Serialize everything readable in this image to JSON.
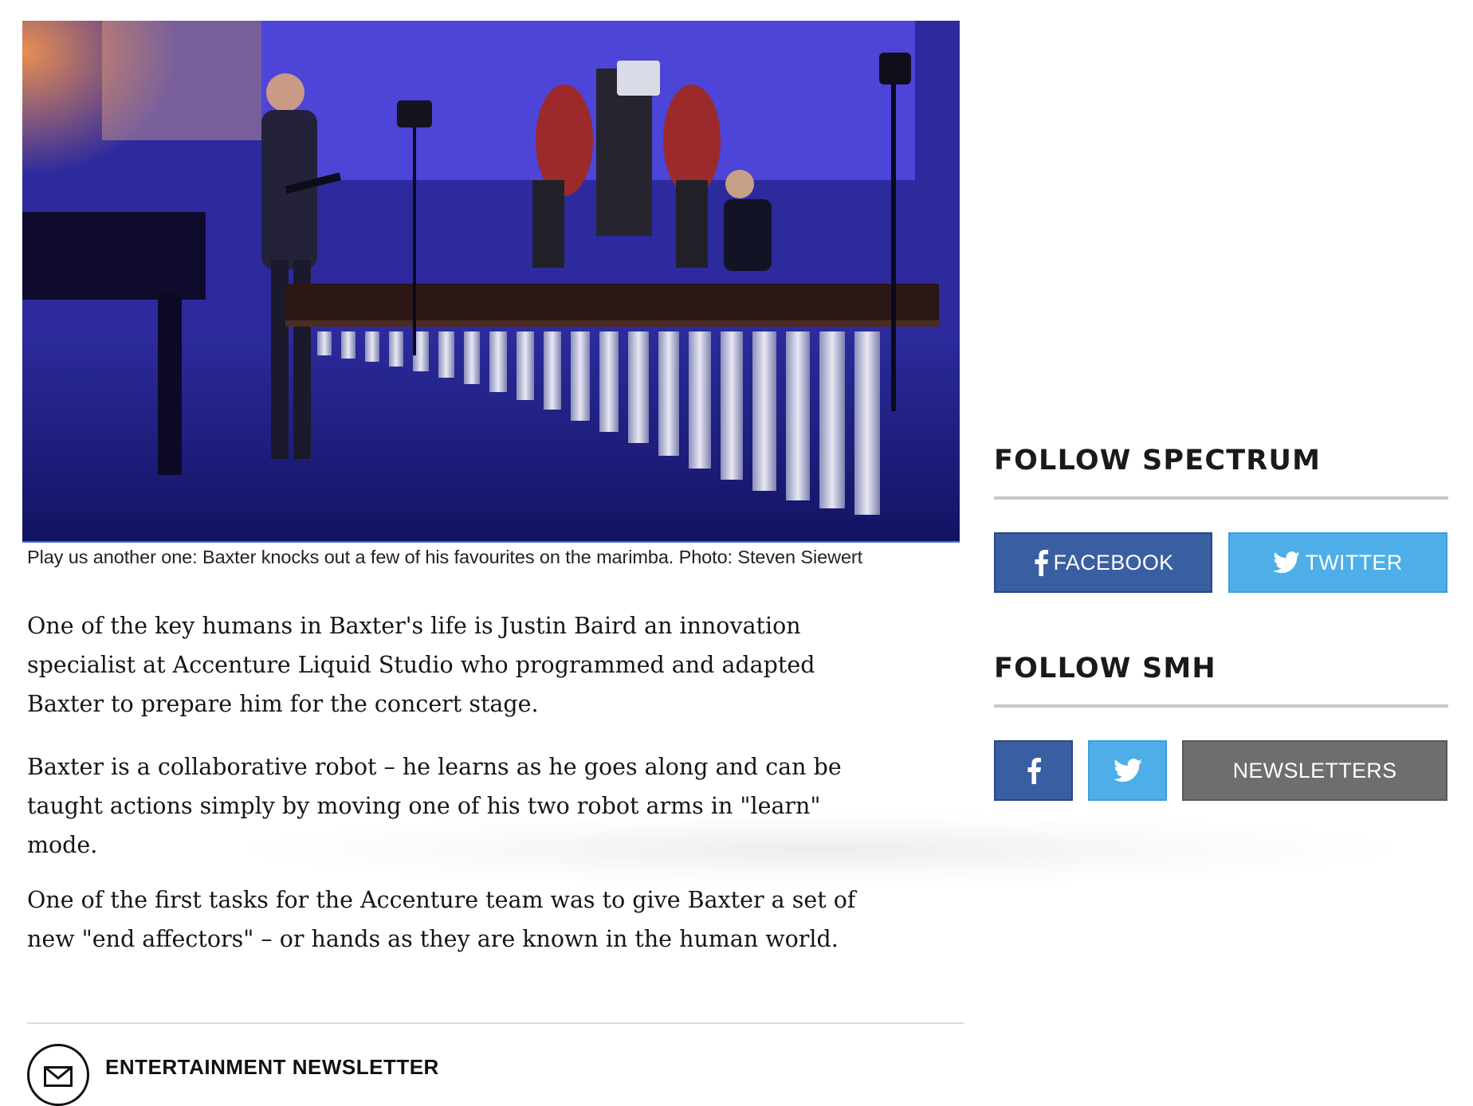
{
  "article": {
    "image_alt": "Baxter robot playing a Yamaha marimba on a concert stage",
    "caption": "Play us another one: Baxter knocks out a few of his favourites on the marimba. Photo: Steven Siewert",
    "paragraphs": [
      "One of the key humans in Baxter's life is Justin Baird an innovation specialist at Accenture Liquid Studio who programmed and adapted Baxter to prepare him for the concert stage.",
      "Baxter is a collaborative robot – he learns as he goes along and can be taught actions simply by moving one of his two robot arms in \"learn\" mode.",
      "One of the first tasks for the Accenture team was to give Baxter a set of new \"end affectors\" – or hands as they are known in the human world."
    ],
    "newsletter_title": "ENTERTAINMENT NEWSLETTER"
  },
  "sidebar": {
    "follow_spectrum": {
      "heading": "FOLLOW SPECTRUM",
      "facebook_label": "FACEBOOK",
      "twitter_label": "TWITTER"
    },
    "follow_smh": {
      "heading": "FOLLOW SMH",
      "newsletters_label": "NEWSLETTERS"
    }
  },
  "colors": {
    "facebook": "#3a5ea2",
    "twitter": "#4eaee7",
    "newsletters": "#6e6e6e"
  },
  "icons": [
    "facebook-icon",
    "twitter-icon",
    "envelope-icon"
  ]
}
